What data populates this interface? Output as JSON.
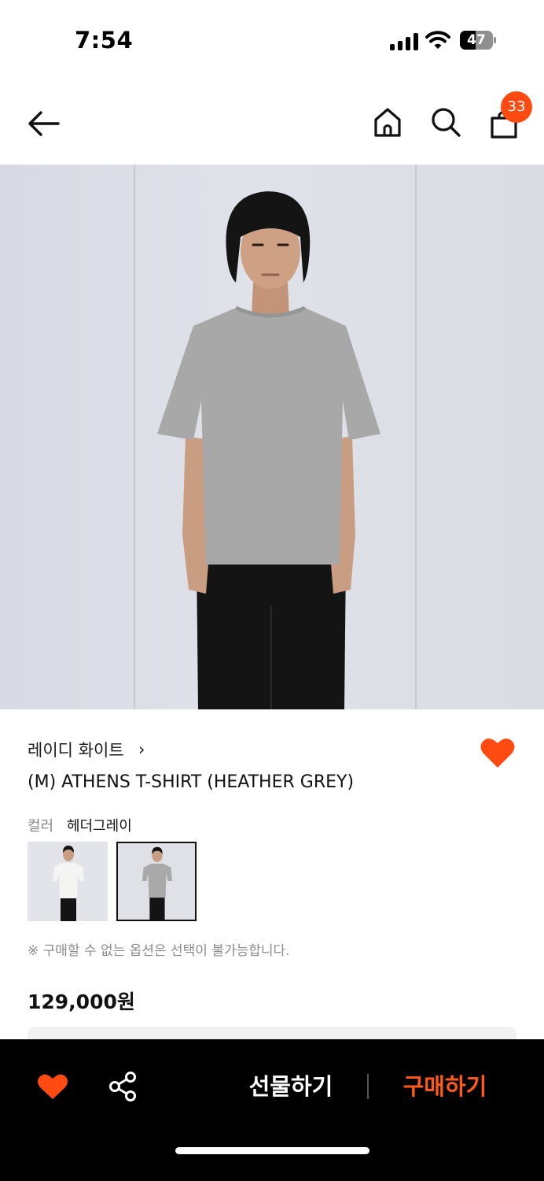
{
  "status_bar": {
    "time": "7:54",
    "battery_level": "47",
    "battery_fraction": 0.47
  },
  "nav": {
    "cart_count": "33",
    "icons": [
      "back-arrow-icon",
      "home-icon",
      "search-icon",
      "shopping-bag-icon"
    ]
  },
  "product": {
    "brand": "레이디 화이트",
    "brand_chevron": "›",
    "title": "(M) ATHENS T-SHIRT (HEATHER GREY)",
    "color_label": "컬러",
    "color_value": "헤더그레이",
    "swatches": [
      {
        "shirt_color": "#f4f4f2",
        "selected": false
      },
      {
        "shirt_color": "#a9a9a9",
        "selected": true
      }
    ],
    "notice": "※ 구매할 수 없는 옵션은 선택이 불가능합니다.",
    "price": "129,000원",
    "wishlisted": true
  },
  "bottom_bar": {
    "gift_label": "선물하기",
    "buy_label": "구매하기"
  },
  "colors": {
    "accent": "#ff4a12",
    "buy_text": "#ff5a1a",
    "bar_bg": "#000000"
  }
}
